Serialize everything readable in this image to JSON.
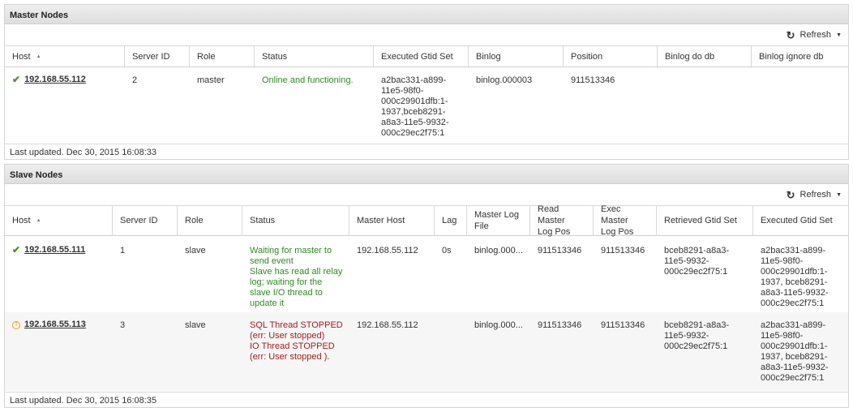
{
  "master": {
    "title": "Master Nodes",
    "refresh_label": "Refresh",
    "columns": [
      "Host",
      "Server ID",
      "Role",
      "Status",
      "Executed Gtid Set",
      "Binlog",
      "Position",
      "Binlog do db",
      "Binlog ignore db"
    ],
    "rows": [
      {
        "status_icon": "check-icon",
        "host": "192.168.55.112",
        "server_id": "2",
        "role": "master",
        "status": "Online and functioning.",
        "gtid_lines": [
          "a2bac331-a899-",
          "11e5-98f0-",
          "000c29901dfb:1-",
          "1937,bceb8291-",
          "a8a3-11e5-9932-",
          "000c29ec2f75:1"
        ],
        "binlog": "binlog.000003",
        "position": "911513346",
        "binlog_do_db": "",
        "binlog_ignore_db": ""
      }
    ],
    "last_updated": "Last updated. Dec 30, 2015 16:08:33"
  },
  "slave": {
    "title": "Slave Nodes",
    "refresh_label": "Refresh",
    "columns": [
      "Host",
      "Server ID",
      "Role",
      "Status",
      "Master Host",
      "Lag",
      "Master Log File",
      "Read Master Log Pos",
      "Exec Master Log Pos",
      "Retrieved Gtid Set",
      "Executed Gtid Set"
    ],
    "column_lines": {
      "master_log_file": [
        "Master Log",
        "File"
      ],
      "read_master_log_pos": [
        "Read Master",
        "Log Pos"
      ],
      "exec_master_log_pos": [
        "Exec Master",
        "Log Pos"
      ]
    },
    "rows": [
      {
        "status_icon": "check-icon",
        "host": "192.168.55.111",
        "server_id": "1",
        "role": "slave",
        "status_lines": [
          "Waiting for master to",
          "send event",
          "Slave has read all relay",
          "log; waiting for the",
          "slave I/O thread to",
          "update it"
        ],
        "status_color": "green",
        "master_host": "192.168.55.112",
        "lag": "0s",
        "master_log_file": "binlog.000...",
        "read_master_log_pos": "911513346",
        "exec_master_log_pos": "911513346",
        "retrieved_gtid_lines": [
          "bceb8291-a8a3-",
          "11e5-9932-",
          "000c29ec2f75:1"
        ],
        "executed_gtid_lines": [
          "a2bac331-a899-",
          "11e5-98f0-",
          "000c29901dfb:1-",
          "1937, bceb8291-",
          "a8a3-11e5-9932-",
          "000c29ec2f75:1"
        ]
      },
      {
        "status_icon": "warning-icon",
        "host": "192.168.55.113",
        "server_id": "3",
        "role": "slave",
        "status_lines": [
          "SQL Thread STOPPED",
          "(err: User stopped)",
          "IO Thread STOPPED",
          "(err: User stopped )."
        ],
        "status_color": "red",
        "master_host": "192.168.55.112",
        "lag": "",
        "master_log_file": "binlog.000...",
        "read_master_log_pos": "911513346",
        "exec_master_log_pos": "911513346",
        "retrieved_gtid_lines": [
          "bceb8291-a8a3-",
          "11e5-9932-",
          "000c29ec2f75:1"
        ],
        "executed_gtid_lines": [
          "a2bac331-a899-",
          "11e5-98f0-",
          "000c29901dfb:1-",
          "1937, bceb8291-",
          "a8a3-11e5-9932-",
          "000c29ec2f75:1"
        ]
      }
    ],
    "last_updated": "Last updated. Dec 30, 2015 16:08:35"
  },
  "colors": {
    "ok_status": "#2e8b1f",
    "error_status": "#a21d1d",
    "ok_icon": "#3a9b22",
    "warning_icon": "#e8a20c",
    "header_bg": "#e4e4e4"
  }
}
